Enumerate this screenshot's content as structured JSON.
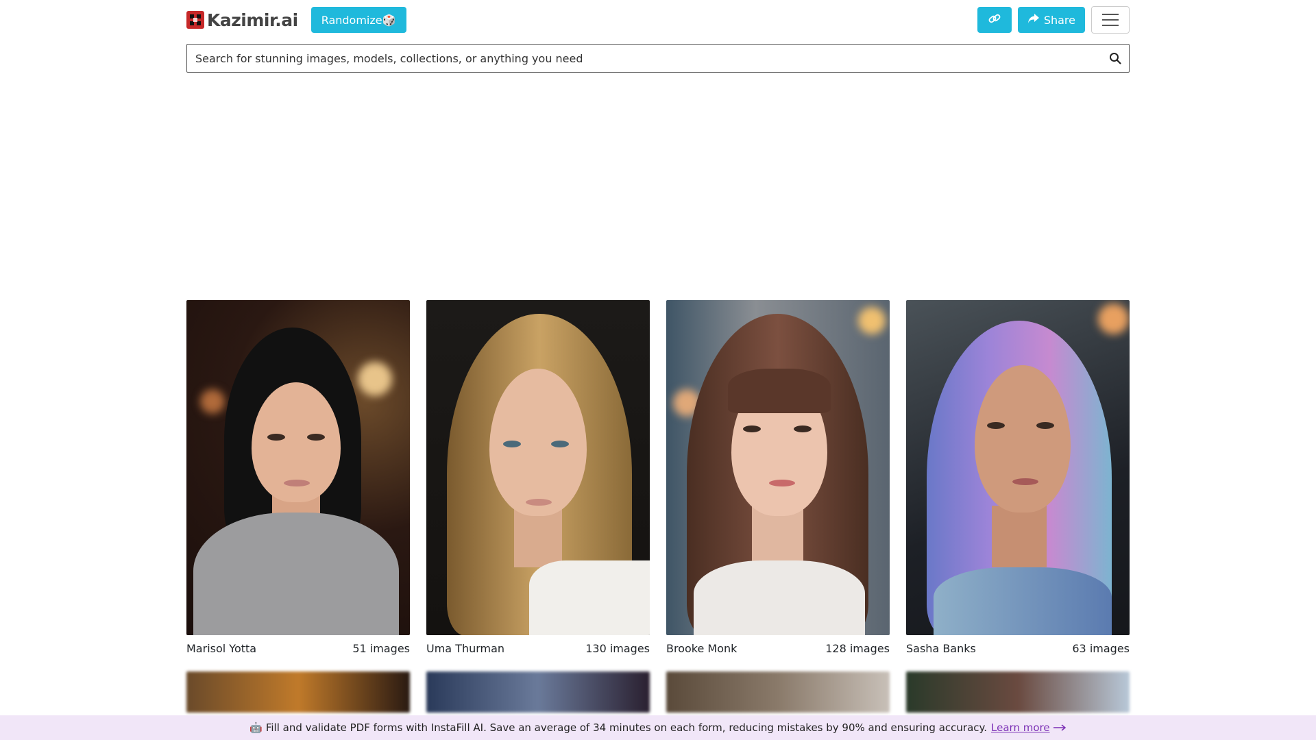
{
  "header": {
    "logo_text": "Kazimir.ai",
    "randomize_label": "Randomize🎲",
    "share_label": "Share"
  },
  "search": {
    "placeholder": "Search for stunning images, models, collections, or anything you need"
  },
  "models": [
    {
      "name": "Marisol Yotta",
      "count": "51 images"
    },
    {
      "name": "Uma Thurman",
      "count": "130 images"
    },
    {
      "name": "Brooke Monk",
      "count": "128 images"
    },
    {
      "name": "Sasha Banks",
      "count": "63 images"
    }
  ],
  "banner": {
    "text": "🤖 Fill and validate PDF forms with InstaFill AI. Save an average of 34 minutes on each form, reducing mistakes by 90% and ensuring accuracy.",
    "link_label": "Learn more"
  },
  "colors": {
    "accent": "#1fb9dc",
    "banner_bg": "#f1e6f8",
    "link": "#7b2fb5"
  },
  "icons": {
    "search": "search-icon",
    "link": "link-icon",
    "share": "share-icon",
    "menu": "hamburger-menu-icon",
    "arrow": "arrow-right-icon"
  }
}
